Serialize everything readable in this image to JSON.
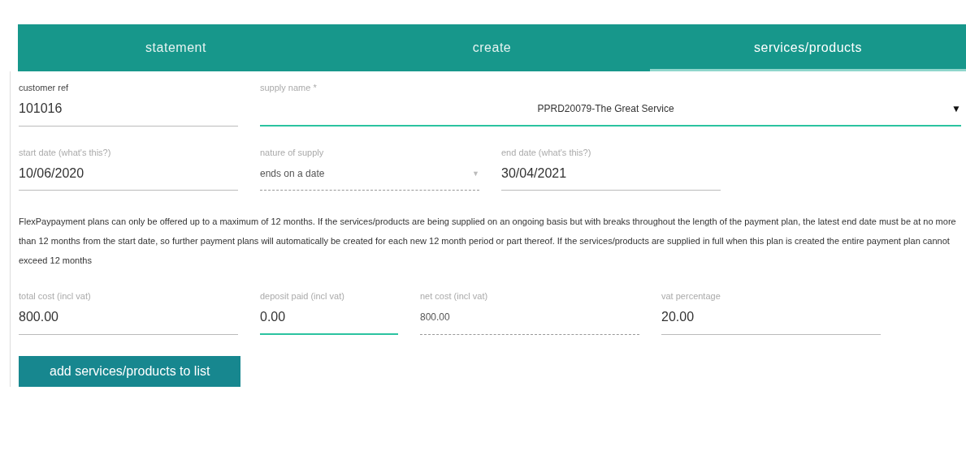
{
  "tabs": [
    {
      "label": "statement",
      "selected": false
    },
    {
      "label": "create",
      "selected": false
    },
    {
      "label": "services/products",
      "selected": true
    }
  ],
  "rows": [
    {
      "fields": [
        {
          "kind": "input",
          "label": "customer ref",
          "value": "101016",
          "focused": false,
          "disabled": false
        },
        {
          "kind": "select",
          "label": "supply name *",
          "value": "PPRD20079-The Great Service",
          "caret": "▼",
          "focused": true,
          "disabled": false
        }
      ]
    },
    {
      "fields": [
        {
          "kind": "input",
          "label": "start date (what's this?)",
          "value": "10/06/2020",
          "focused": false,
          "disabled": false
        },
        {
          "kind": "select",
          "label": "nature of supply",
          "value": "ends on a date",
          "caret": "▼",
          "focused": false,
          "disabled": true
        },
        {
          "kind": "input",
          "label": "end date (what's this?)",
          "value": "30/04/2021",
          "focused": false,
          "disabled": false
        }
      ]
    }
  ],
  "notice": "FlexPaypayment plans can only be offered up to a maximum of 12 months. If the services/products are being supplied on an ongoing basis but with breaks throughout the length of the payment plan, the latest end date must be at no more than 12 months from the start date, so further payment plans will automatically be created for each new 12 month period or part thereof. If the services/products are supplied in full when this plan is created the entire payment plan cannot exceed 12 months",
  "cost_row": {
    "fields": [
      {
        "kind": "input",
        "label": "total cost (incl vat)",
        "value": "800.00",
        "focused": false,
        "disabled": false
      },
      {
        "kind": "input",
        "label": "deposit paid (incl vat)",
        "value": "0.00",
        "focused": true,
        "disabled": false
      },
      {
        "kind": "input",
        "label": "net cost (incl vat)",
        "value": "800.00",
        "focused": false,
        "disabled": true
      },
      {
        "kind": "input",
        "label": "vat percentage",
        "value": "20.00",
        "focused": false,
        "disabled": false
      }
    ]
  },
  "button": {
    "label": "add services/products to list"
  }
}
